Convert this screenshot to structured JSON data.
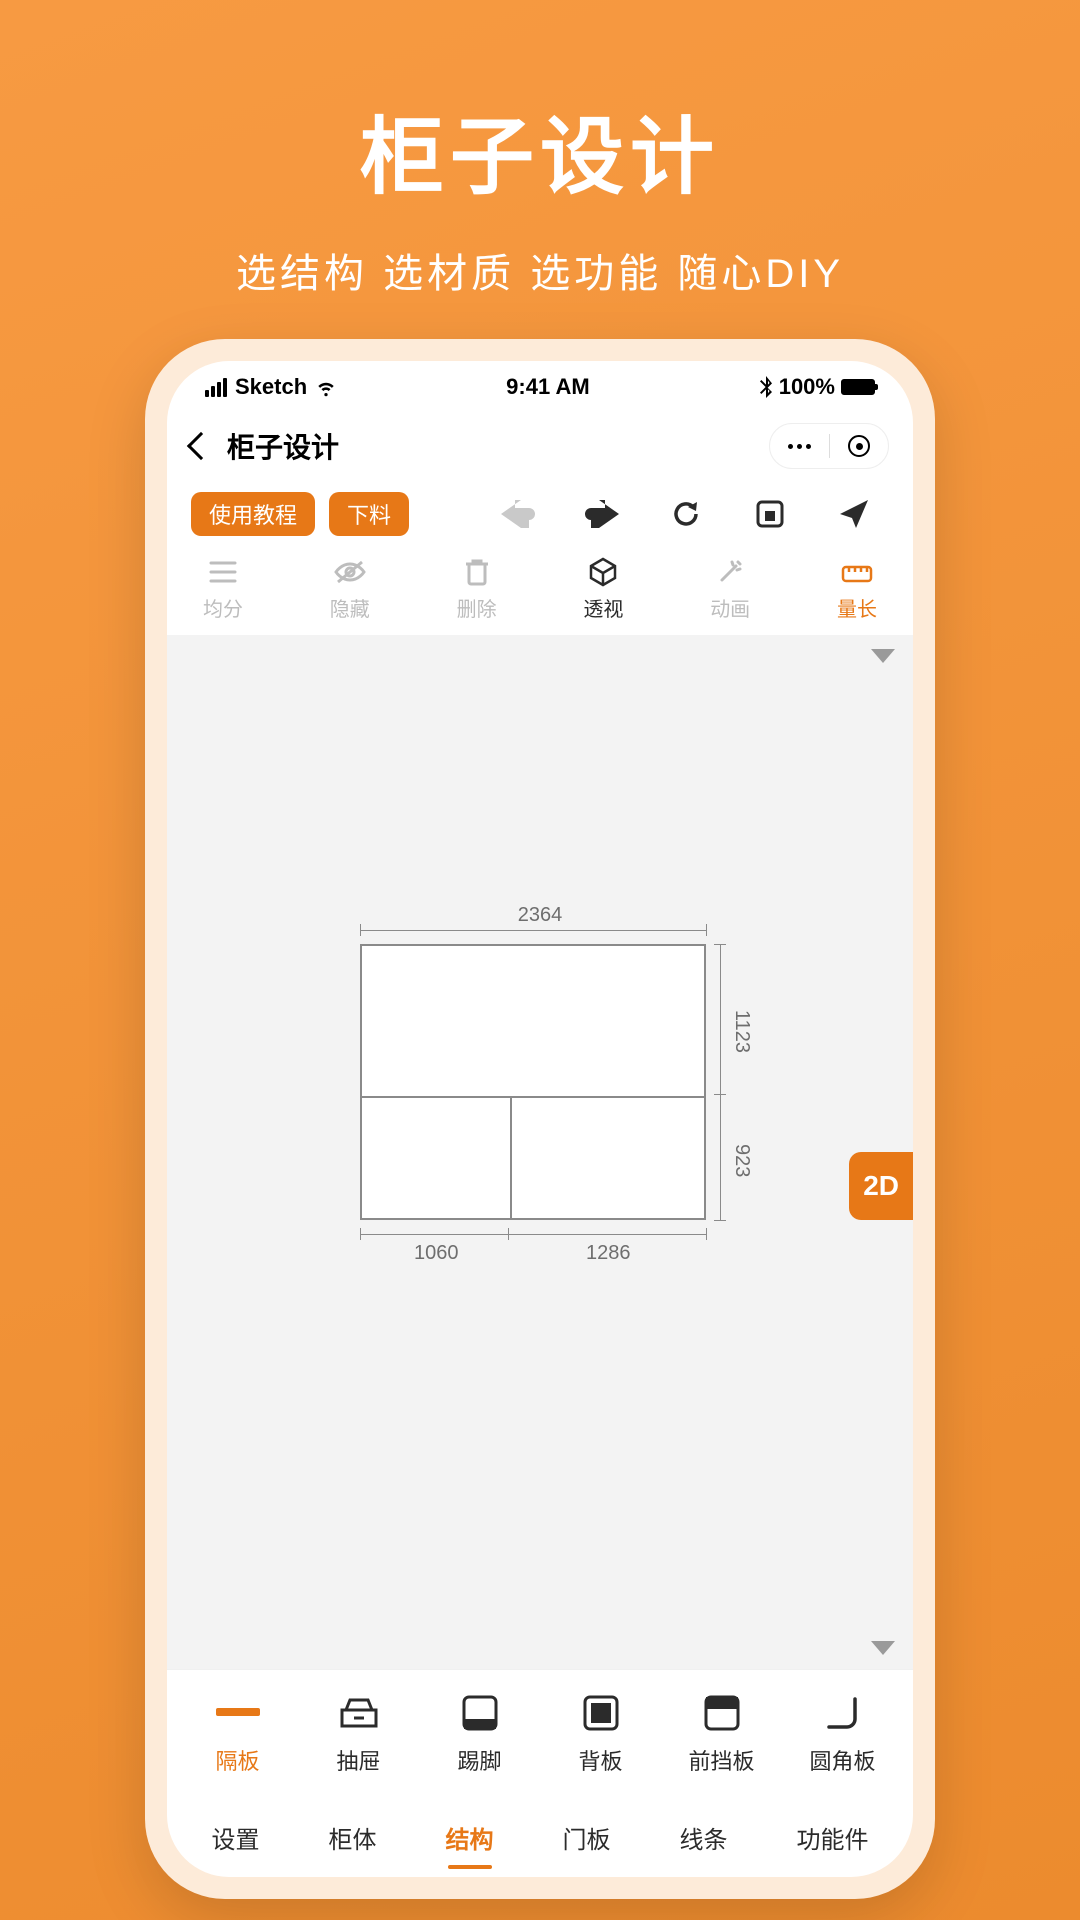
{
  "hero": {
    "title": "柜子设计",
    "subtitle": "选结构 选材质 选功能 随心DIY"
  },
  "statusbar": {
    "carrier": "Sketch",
    "time": "9:41 AM",
    "battery": "100%"
  },
  "nav": {
    "title": "柜子设计"
  },
  "toolbar": {
    "tutorial": "使用教程",
    "cut": "下料"
  },
  "toolbar2": {
    "divide": "均分",
    "hide": "隐藏",
    "delete": "删除",
    "perspective": "透视",
    "animation": "动画",
    "measure": "量长"
  },
  "canvas": {
    "view_mode": "2D",
    "dims": {
      "top": "2364",
      "right_upper": "1123",
      "right_lower": "923",
      "bottom_left": "1060",
      "bottom_right": "1286"
    }
  },
  "bottom1": {
    "partition": "隔板",
    "drawer": "抽屉",
    "kick": "踢脚",
    "back": "背板",
    "front": "前挡板",
    "round": "圆角板"
  },
  "bottom2": {
    "settings": "设置",
    "cabinet": "柜体",
    "structure": "结构",
    "door": "门板",
    "line": "线条",
    "feature": "功能件"
  }
}
